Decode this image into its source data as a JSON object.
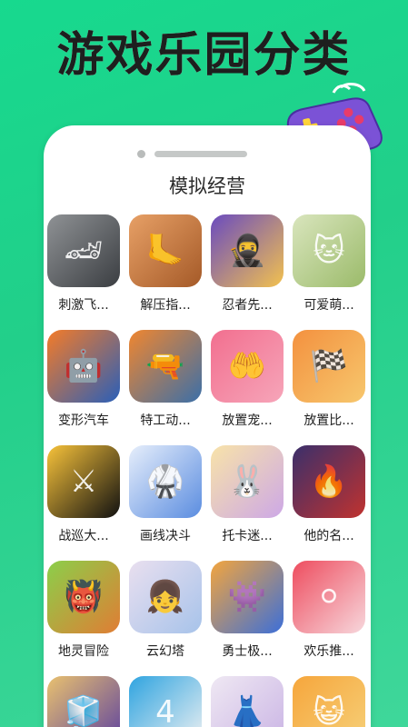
{
  "headline": "游戏乐园分类",
  "section_title": "模拟经营",
  "apps": [
    {
      "label": "刺激飞...",
      "icon": "race-car-icon",
      "colors": [
        "#8f9295",
        "#3b3e42"
      ],
      "glyph": "🏎"
    },
    {
      "label": "解压指...",
      "icon": "foot-massage-icon",
      "colors": [
        "#e7a066",
        "#a55a28"
      ],
      "glyph": "🦶"
    },
    {
      "label": "忍者先...",
      "icon": "ninja-icon",
      "colors": [
        "#6a4bbf",
        "#f2c14f"
      ],
      "glyph": "🥷"
    },
    {
      "label": "可爱萌...",
      "icon": "cat-icon",
      "colors": [
        "#d9e5bd",
        "#9bbb6a"
      ],
      "glyph": "🐱"
    },
    {
      "label": "变形汽车",
      "icon": "robot-car-icon",
      "colors": [
        "#f47b28",
        "#2a5fb8"
      ],
      "glyph": "🤖"
    },
    {
      "label": "特工动...",
      "icon": "agent-icon",
      "colors": [
        "#f0862f",
        "#3b6fa8"
      ],
      "glyph": "🔫"
    },
    {
      "label": "放置宠...",
      "icon": "pet-hand-icon",
      "colors": [
        "#f26f8f",
        "#f6a5b9"
      ],
      "glyph": "🤲"
    },
    {
      "label": "放置比...",
      "icon": "race-track-icon",
      "colors": [
        "#f3913f",
        "#f7c76d"
      ],
      "glyph": "🏁"
    },
    {
      "label": "战巡大...",
      "icon": "silhouette-war-icon",
      "colors": [
        "#f7c23a",
        "#111111"
      ],
      "glyph": "⚔"
    },
    {
      "label": "画线决斗",
      "icon": "blue-fighter-icon",
      "colors": [
        "#e6eefb",
        "#5b8de0"
      ],
      "glyph": "🥋"
    },
    {
      "label": "托卡迷...",
      "icon": "toca-bunny-icon",
      "colors": [
        "#f8e3a9",
        "#cda8e6"
      ],
      "glyph": "🐰"
    },
    {
      "label": "他的名...",
      "icon": "mage-icon",
      "colors": [
        "#3a2f6b",
        "#c0322f"
      ],
      "glyph": "🔥"
    },
    {
      "label": "地灵冒险",
      "icon": "orc-icon",
      "colors": [
        "#8bcf4a",
        "#e07d34"
      ],
      "glyph": "👹"
    },
    {
      "label": "云幻塔",
      "icon": "anime-girl-icon",
      "colors": [
        "#e9dfef",
        "#a7c3ea"
      ],
      "glyph": "👧"
    },
    {
      "label": "勇士极...",
      "icon": "blue-monster-icon",
      "colors": [
        "#f3a53e",
        "#3c6fd8"
      ],
      "glyph": "👾"
    },
    {
      "label": "欢乐推...",
      "icon": "coin-pusher-icon",
      "colors": [
        "#ee4d5f",
        "#f7d7dc"
      ],
      "glyph": "⚪"
    },
    {
      "label": "",
      "icon": "rubik-cube-icon",
      "colors": [
        "#e9c16f",
        "#5a3fa0"
      ],
      "glyph": "🧊"
    },
    {
      "label": "",
      "icon": "number-puzzle-icon",
      "colors": [
        "#2fa4e0",
        "#f2f2f2"
      ],
      "glyph": "4"
    },
    {
      "label": "",
      "icon": "doll-dressup-icon",
      "colors": [
        "#efe8f3",
        "#c9b3e4"
      ],
      "glyph": "👗"
    },
    {
      "label": "",
      "icon": "cartoon-cat-icon",
      "colors": [
        "#f6a63c",
        "#f6d17a"
      ],
      "glyph": "😺"
    }
  ],
  "gamepad": {
    "body": "#7b52d6",
    "button_plus": "#ffd43b",
    "buttons": "#e83b6a",
    "icon": "gamepad-icon"
  }
}
